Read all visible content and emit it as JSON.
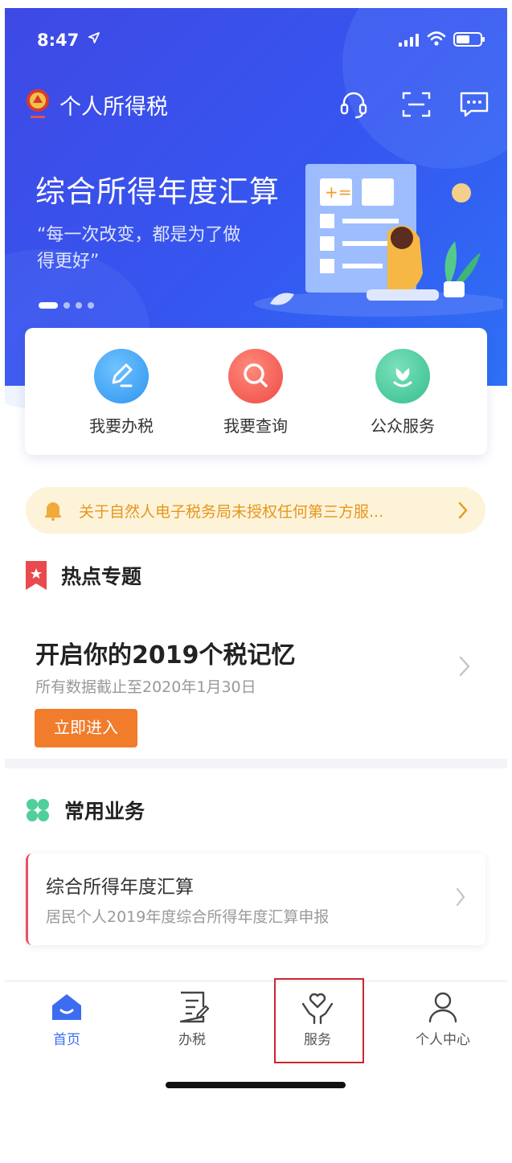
{
  "status_bar": {
    "time": "8:47"
  },
  "header": {
    "app_title": "个人所得税",
    "emblem_text": "中国税务",
    "icons": [
      "customer-service-icon",
      "scan-icon",
      "message-icon"
    ]
  },
  "banner": {
    "title": "综合所得年度汇算",
    "subtitle": "“每一次改变，都是为了做得更好”",
    "slide_count": 4,
    "active_slide": 1
  },
  "quick_actions": [
    {
      "label": "我要办税",
      "icon": "pencil-icon",
      "color": "#3aa5f5"
    },
    {
      "label": "我要查询",
      "icon": "search-icon",
      "color": "#f3534f"
    },
    {
      "label": "公众服务",
      "icon": "flower-icon",
      "color": "#3ec99a"
    }
  ],
  "notice": {
    "text": "关于自然人电子税务局未授权任何第三方服...",
    "color": "#e6961c"
  },
  "hot_topic": {
    "section_title": "热点专题",
    "title": "开启你的2019个税记忆",
    "subtitle": "所有数据截止至2020年1月30日",
    "button_label": "立即进入"
  },
  "common_business": {
    "section_title": "常用业务",
    "items": [
      {
        "title": "综合所得年度汇算",
        "subtitle": "居民个人2019年度综合所得年度汇算申报"
      }
    ]
  },
  "tab_bar": {
    "tabs": [
      {
        "label": "首页",
        "icon": "home-icon",
        "active": true
      },
      {
        "label": "办税",
        "icon": "document-edit-icon",
        "active": false
      },
      {
        "label": "服务",
        "icon": "heart-hands-icon",
        "active": false
      },
      {
        "label": "个人中心",
        "icon": "person-icon",
        "active": false
      }
    ],
    "highlighted_tab": "服务"
  },
  "colors": {
    "brand_blue": "#3656f0",
    "accent_orange": "#f07c2c",
    "active_tab": "#3c6cf0"
  }
}
